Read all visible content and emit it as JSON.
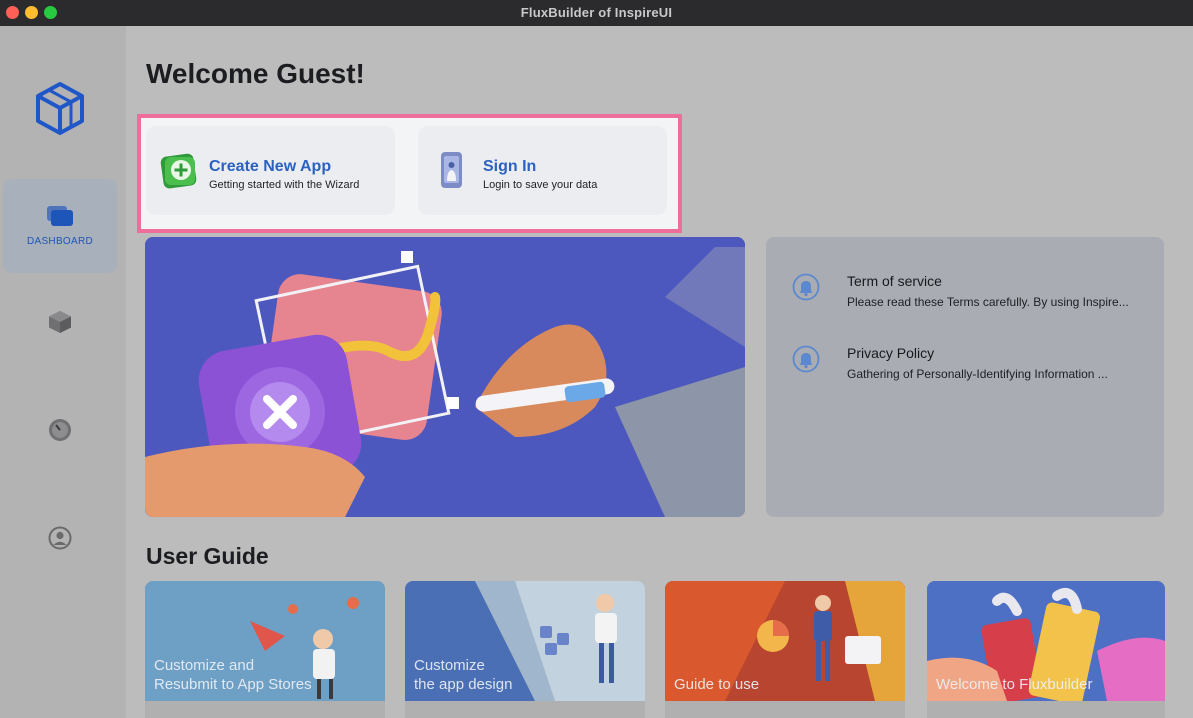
{
  "window": {
    "title": "FluxBuilder of InspireUI"
  },
  "sidebar": {
    "items": [
      {
        "label": "DASHBOARD",
        "icon": "dashboard-icon",
        "active": true
      },
      {
        "label": "",
        "icon": "cube-icon"
      },
      {
        "label": "",
        "icon": "clock-icon"
      },
      {
        "label": "",
        "icon": "account-icon"
      }
    ]
  },
  "main": {
    "welcome": "Welcome Guest!",
    "actions": [
      {
        "title": "Create New App",
        "subtitle": "Getting started with the Wizard",
        "icon": "add-app-icon"
      },
      {
        "title": "Sign In",
        "subtitle": "Login to save your data",
        "icon": "phone-touch-icon"
      }
    ],
    "info": [
      {
        "title": "Term of service",
        "desc": "Please read these Terms carefully. By using Inspire..."
      },
      {
        "title": "Privacy Policy",
        "desc": "Gathering of Personally-Identifying Information ..."
      }
    ],
    "user_guide_title": "User Guide",
    "guides": [
      {
        "line1": "Customize and",
        "line2": "Resubmit to App Stores"
      },
      {
        "line1": "Customize",
        "line2": "the app design"
      },
      {
        "line1": "",
        "line2": "Guide to use"
      },
      {
        "line1": "",
        "line2": "Welcome to Fluxbuilder"
      }
    ]
  },
  "colors": {
    "accent": "#2b62c2",
    "highlight": "#ee6e9b",
    "titlebar": "#2b2b2d"
  }
}
